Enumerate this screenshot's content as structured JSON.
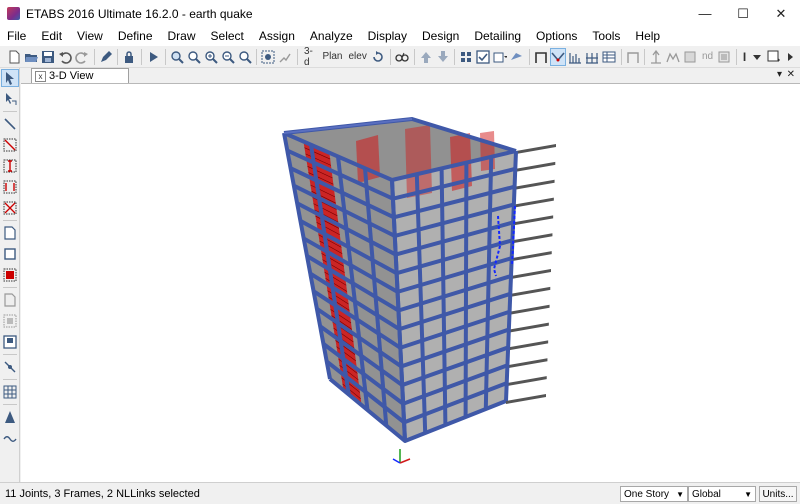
{
  "window": {
    "title": "ETABS 2016 Ultimate 16.2.0 - earth quake",
    "minimize_glyph": "—",
    "maximize_glyph": "☐",
    "close_glyph": "✕"
  },
  "menu": [
    "File",
    "Edit",
    "View",
    "Define",
    "Draw",
    "Select",
    "Assign",
    "Analyze",
    "Display",
    "Design",
    "Detailing",
    "Options",
    "Tools",
    "Help"
  ],
  "toolbar": {
    "view_3d_label": "3-d",
    "plan_view_label": "Plan",
    "elev_view_label": "elev",
    "nd_label": "nd",
    "text_tool_label": "I"
  },
  "tab": {
    "label": "3-D View",
    "close_glyph": "x",
    "dropdown_glyph": "▾",
    "close_window_glyph": "✕"
  },
  "status": {
    "selection_text": "11 Joints, 3 Frames, 2 NLLinks selected",
    "story_option": "One Story",
    "coord_system": "Global",
    "units_button": "Units..."
  },
  "colors": {
    "frame_blue": "#3f58a8",
    "wall_red": "#d11a1a",
    "slab_gray": "#7e7e7e",
    "selected_blue": "#1428ff",
    "active_tool": "#cfe3f7"
  }
}
